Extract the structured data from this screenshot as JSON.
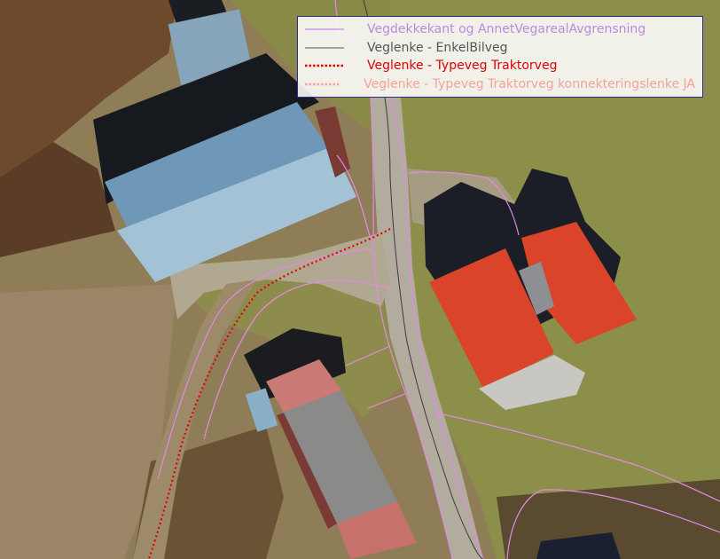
{
  "map": {
    "colors": {
      "background": "#8a7a55",
      "road_asphalt": "#b2ac9f",
      "gravel_area": "#b1a892",
      "grass": "#8c8f4a",
      "field": "#6e4a2c",
      "barn_roof": "#6f98b8",
      "house_roof": "#d9442a",
      "shed_roof": "#8a8a88"
    }
  },
  "legend": {
    "items": [
      {
        "label": "Vegdekkekant og AnnetVegarealAvgrensning",
        "color": "#c48ae6",
        "text_color": "#b98be0",
        "style": "solid",
        "icon": "line-solid-violet"
      },
      {
        "label": "Veglenke - EnkelBilveg",
        "color": "#555555",
        "text_color": "#555555",
        "style": "solid",
        "icon": "line-solid-gray"
      },
      {
        "label": "Veglenke - Typeveg Traktorveg",
        "color": "#e00000",
        "text_color": "#e00000",
        "style": "dotted",
        "icon": "line-dotted-red"
      },
      {
        "label": "Veglenke - Typeveg Traktorveg konnekteringslenke JA",
        "color": "#f2a39a",
        "text_color": "#f2a39a",
        "style": "dotted",
        "icon": "line-dotted-pink"
      }
    ]
  }
}
